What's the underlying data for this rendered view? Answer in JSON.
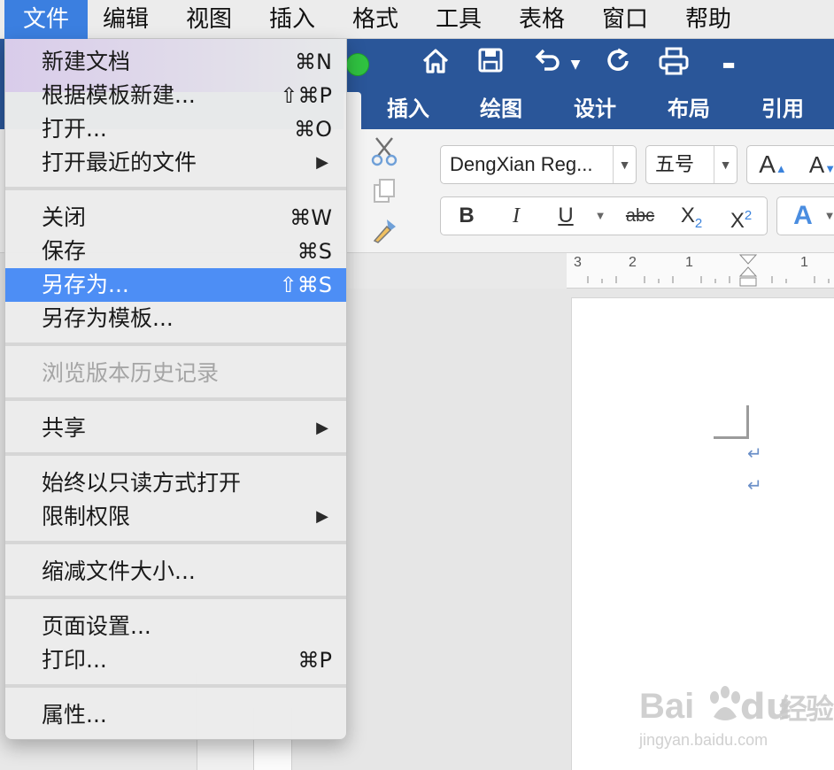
{
  "menubar": {
    "items": [
      "文件",
      "编辑",
      "视图",
      "插入",
      "格式",
      "工具",
      "表格",
      "窗口",
      "帮助"
    ]
  },
  "ribbon": {
    "tabs": [
      "插入",
      "绘图",
      "设计",
      "布局",
      "引用"
    ],
    "font_name": "DengXian Reg...",
    "font_size": "五号",
    "bold": "B",
    "italic": "I",
    "underline": "U",
    "strike": "abc",
    "subscript": "X",
    "subscript_mark": "2",
    "superscript": "X",
    "superscript_mark": "2",
    "grow_font": "A",
    "shrink_font": "A",
    "text_effect": "A"
  },
  "ruler": {
    "labels": [
      "3",
      "2",
      "1",
      "1"
    ]
  },
  "file_menu": {
    "items": [
      {
        "label": "新建文档",
        "shortcut": "⌘N"
      },
      {
        "label": "根据模板新建...",
        "shortcut": "⇧⌘P"
      },
      {
        "label": "打开...",
        "shortcut": "⌘O"
      },
      {
        "label": "打开最近的文件",
        "submenu": "▶"
      },
      {
        "label": "关闭",
        "shortcut": "⌘W"
      },
      {
        "label": "保存",
        "shortcut": "⌘S"
      },
      {
        "label": "另存为...",
        "shortcut": "⇧⌘S",
        "selected": true
      },
      {
        "label": "另存为模板..."
      },
      {
        "label": "浏览版本历史记录",
        "disabled": true
      },
      {
        "label": "共享",
        "submenu": "▶"
      },
      {
        "label": "始终以只读方式打开"
      },
      {
        "label": "限制权限",
        "submenu": "▶"
      },
      {
        "label": "缩减文件大小..."
      },
      {
        "label": "页面设置..."
      },
      {
        "label": "打印...",
        "shortcut": "⌘P"
      },
      {
        "label": "属性..."
      }
    ]
  },
  "watermark": {
    "brand": "Bai",
    "brand2": "du",
    "product": "经验",
    "url": "jingyan.baidu.com"
  },
  "colors": {
    "selection": "#4d8ef5",
    "menubar_active": "#3b7fe0",
    "word_blue": "#2a5699"
  }
}
